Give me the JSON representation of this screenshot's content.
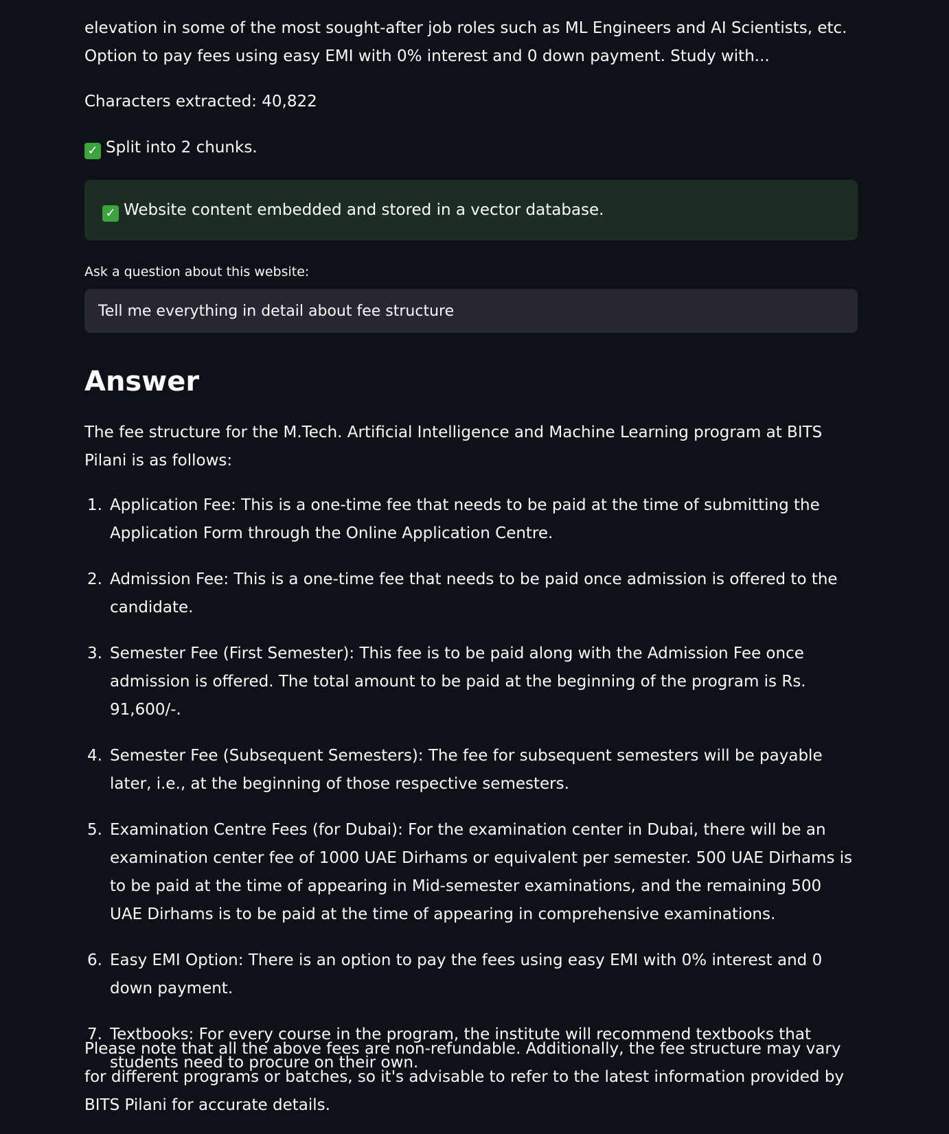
{
  "intro_text": "elevation in some of the most sought-after job roles such as ML Engineers and AI Scientists, etc.  Option to pay fees using easy EMI with 0% interest and 0 down payment. Study with...",
  "characters_extracted": "Characters extracted: 40,822",
  "split_status": {
    "icon": "check-mark-icon",
    "text": "Split into 2 chunks."
  },
  "success_alert": {
    "icon": "check-mark-icon",
    "text": "Website content embedded and stored in a vector database."
  },
  "question": {
    "label": "Ask a question about this website:",
    "value": "Tell me everything in detail about fee structure"
  },
  "answer": {
    "heading": "Answer",
    "intro": "The fee structure for the M.Tech. Artificial Intelligence and Machine Learning program at BITS Pilani is as follows:",
    "items": [
      {
        "num": "1.",
        "text": "Application Fee: This is a one-time fee that needs to be paid at the time of submitting the Application Form through the Online Application Centre."
      },
      {
        "num": "2.",
        "text": "Admission Fee: This is a one-time fee that needs to be paid once admission is offered to the candidate."
      },
      {
        "num": "3.",
        "text": "Semester Fee (First Semester): This fee is to be paid along with the Admission Fee once admission is offered. The total amount to be paid at the beginning of the program is Rs. 91,600/-."
      },
      {
        "num": "4.",
        "text": "Semester Fee (Subsequent Semesters): The fee for subsequent semesters will be payable later, i.e., at the beginning of those respective semesters."
      },
      {
        "num": "5.",
        "text": "Examination Centre Fees (for Dubai): For the examination center in Dubai, there will be an examination center fee of 1000 UAE Dirhams or equivalent per semester. 500 UAE Dirhams is to be paid at the time of appearing in Mid-semester examinations, and the remaining 500 UAE Dirhams is to be paid at the time of appearing in comprehensive examinations."
      },
      {
        "num": "6.",
        "text": "Easy EMI Option: There is an option to pay the fees using easy EMI with 0% interest and 0 down payment."
      },
      {
        "num": "7.",
        "text": "Textbooks: For every course in the program, the institute will recommend textbooks that students need to procure on their own."
      }
    ],
    "note": "Please note that all the above fees are non-refundable. Additionally, the fee structure may vary for different programs or batches, so it's advisable to refer to the latest information provided by BITS Pilani for accurate details."
  },
  "colors": {
    "background": "#0e1117",
    "text": "#fafafa",
    "success_bg": "#1c2e24",
    "input_bg": "#262730",
    "check_green": "#3ea23e"
  }
}
